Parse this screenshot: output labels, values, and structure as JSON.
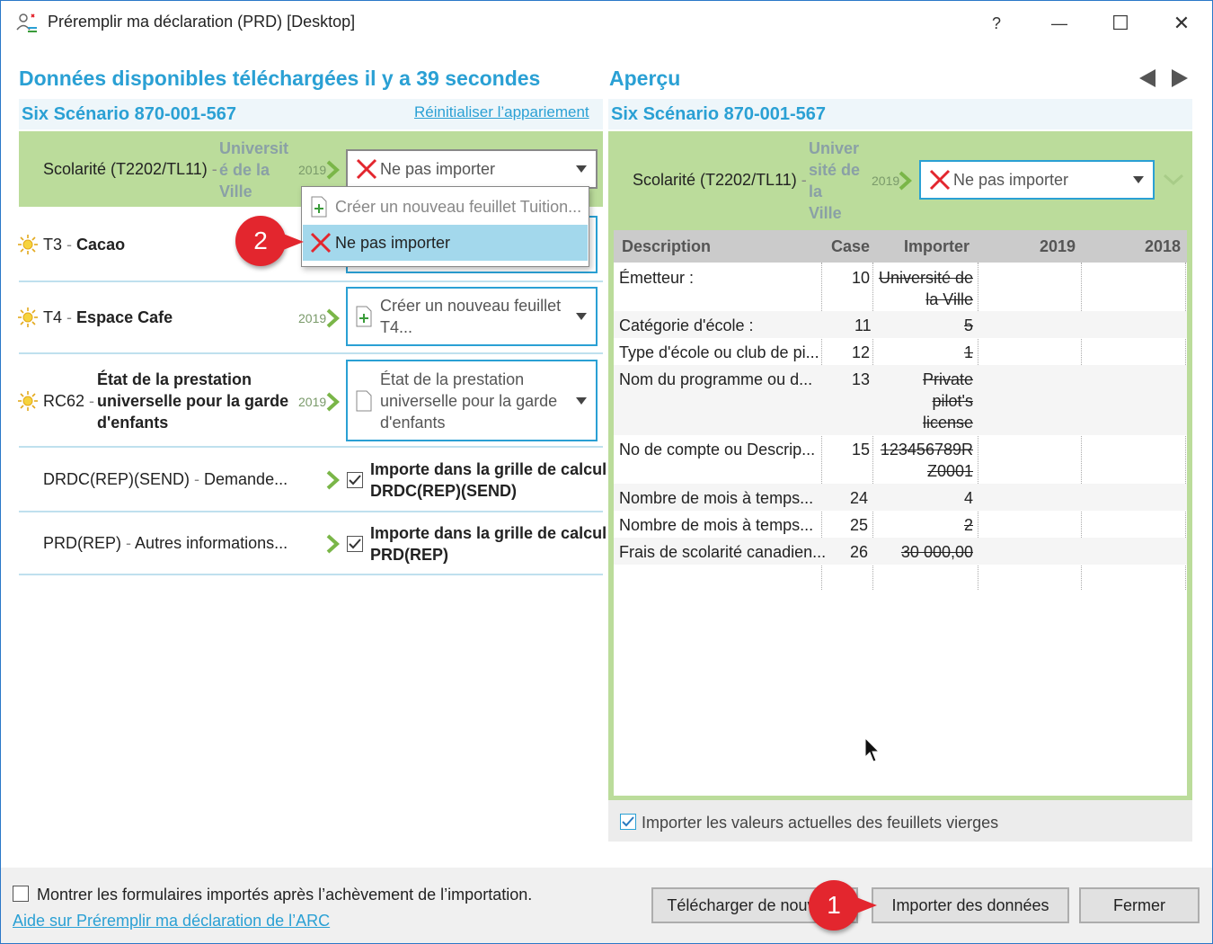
{
  "window": {
    "title": "Préremplir ma déclaration (PRD) [Desktop]",
    "help": "?",
    "minimize": "—",
    "maximize": "☐",
    "close": "✕"
  },
  "left": {
    "heading": "Données disponibles téléchargées il y a 39 secondes",
    "client": "Six Scénario 870-001-567",
    "reset_link": "Réinitialiser l’appariement",
    "rows": [
      {
        "code": "Scolarité (T2202/TL11)",
        "sep": "-",
        "issuer": "Universit é de la Ville",
        "issuer_lines": [
          "Universit",
          "é de la",
          "Ville"
        ],
        "year": "2019",
        "combo": "Ne pas importer"
      },
      {
        "code": "T3",
        "sep": "-",
        "name": "Cacao"
      },
      {
        "code": "T4",
        "sep": "-",
        "name": "Espace Cafe",
        "year": "2019",
        "combo_lines": [
          "Créer un nouveau feuillet",
          "T4..."
        ]
      },
      {
        "code": "RC62",
        "sep": "-",
        "name_lines": [
          "État de la prestation",
          "universelle pour la garde",
          "d'enfants"
        ],
        "year": "2019",
        "combo_lines": [
          "État de la prestation",
          "universelle pour la garde",
          "d'enfants"
        ]
      },
      {
        "code": "DRDC(REP)(SEND)",
        "sep": "-",
        "name": "Demande...",
        "check_lines": [
          "Importe dans la grille de calcul",
          "DRDC(REP)(SEND)"
        ]
      },
      {
        "code": "PRD(REP)",
        "sep": "-",
        "name": "Autres informations...",
        "check_lines": [
          "Importe dans la grille de calcul",
          "PRD(REP)"
        ]
      }
    ],
    "dropdown": {
      "items": [
        "Créer un nouveau feuillet Tuition...",
        "Ne pas importer"
      ],
      "selected": 1
    }
  },
  "right": {
    "heading": "Aperçu",
    "client": "Six Scénario 870-001-567",
    "slip_code": "Scolarité (T2202/TL11)",
    "slip_sep": "-",
    "issuer_lines": [
      "Univer",
      "sité de",
      "la",
      "Ville"
    ],
    "year": "2019",
    "combo": "Ne pas importer",
    "table": {
      "headers": [
        "Description",
        "Case",
        "Importer",
        "2019",
        "2018"
      ],
      "rows": [
        {
          "desc": "Émetteur :",
          "case": "10",
          "import_lines": [
            "Université de",
            "la Ville"
          ]
        },
        {
          "desc": "Catégorie d'école :",
          "case": "11",
          "import_lines": [
            "5"
          ]
        },
        {
          "desc": "Type d'école ou club de pi...",
          "case": "12",
          "import_lines": [
            "1"
          ]
        },
        {
          "desc": "Nom du programme ou d...",
          "case": "13",
          "import_lines": [
            "Private",
            "pilot's",
            "license"
          ]
        },
        {
          "desc": "No de compte ou Descrip...",
          "case": "15",
          "import_lines": [
            "123456789R",
            "Z0001"
          ]
        },
        {
          "desc": "Nombre de mois à temps...",
          "case": "24",
          "import_lines": [
            "4"
          ]
        },
        {
          "desc": "Nombre de mois à temps...",
          "case": "25",
          "import_lines": [
            "2"
          ]
        },
        {
          "desc": "Frais de scolarité canadien...",
          "case": "26",
          "import_lines": [
            "30 000,00"
          ]
        }
      ]
    },
    "blank_slips_label": "Importer les valeurs actuelles des feuillets vierges"
  },
  "bottom": {
    "show_forms_label": "Montrer les formulaires importés après l’achèvement de l’importation.",
    "help_link": "Aide sur Préremplir ma déclaration de l’ARC",
    "download_button": "Télécharger de nouveau",
    "import_button": "Importer des données",
    "close_button": "Fermer"
  },
  "badges": [
    "1",
    "2"
  ],
  "colors": {
    "accent": "#2aa0d4",
    "green": "#bbdc9b",
    "badge": "#e3262e"
  }
}
